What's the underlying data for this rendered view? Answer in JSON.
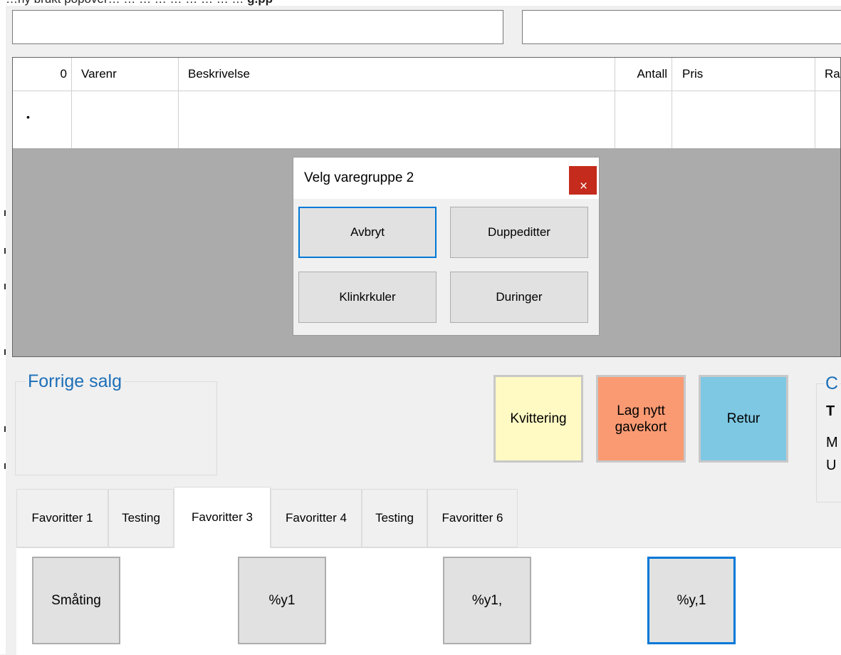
{
  "top_strip": {
    "text": "…ny brukt popover… … … … … … … … …",
    "bold_text": "g.pp"
  },
  "grid": {
    "columns": [
      "0",
      "Varenr",
      "Beskrivelse",
      "Antall",
      "Pris",
      "Ra"
    ],
    "new_row_marker": "•"
  },
  "dialog": {
    "title": "Velg varegruppe 2",
    "close_symbol": "×",
    "buttons": [
      "Avbryt",
      "Duppeditter",
      "Klinkrkuler",
      "Duringer"
    ]
  },
  "previous_sale": {
    "title": "Forrige salg"
  },
  "action_buttons": [
    {
      "label": "Kvittering",
      "color": "#fff9c4"
    },
    {
      "label": "Lag nytt\ngavekort",
      "color": "#fa9a73"
    },
    {
      "label": "Retur",
      "color": "#7ec8e3"
    }
  ],
  "right_panel_fragments": {
    "title": "C",
    "line1": "T",
    "line2": "M",
    "line3": "U"
  },
  "tabs": [
    "Favoritter 1",
    "Testing",
    "Favoritter 3",
    "Favoritter 4",
    "Testing",
    "Favoritter 6"
  ],
  "active_tab_index": 2,
  "favorite_buttons": [
    "Småting",
    "%y1",
    "%y1,",
    "%y,1"
  ],
  "colors": {
    "accent": "#0078d7",
    "group_title": "#1c6fb8",
    "close_button": "#c42b1c"
  }
}
